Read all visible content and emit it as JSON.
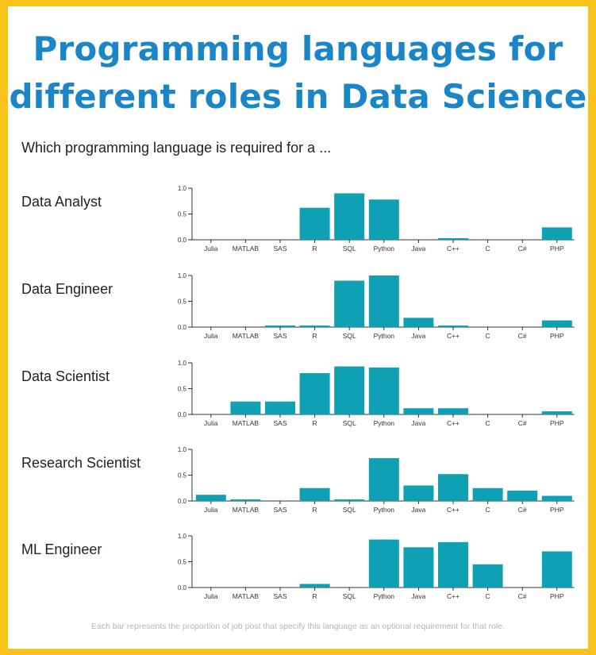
{
  "title": "Programming languages for different roles in Data Science",
  "subtitle": "Which programming language is required for a ...",
  "footnote": "Each bar represents the proportion of job post that specify this language as an optional requirement for that role.",
  "colors": {
    "border": "#f7c21a",
    "title": "#1a86c8",
    "bar": "#10a0b4"
  },
  "chart_data": {
    "type": "bar",
    "categories": [
      "Julia",
      "MATLAB",
      "SAS",
      "R",
      "SQL",
      "Python",
      "Java",
      "C++",
      "C",
      "C#",
      "PHP"
    ],
    "yticks": [
      "0.0",
      "0.5",
      "1.0"
    ],
    "ylim": [
      0,
      1.0
    ],
    "series": [
      {
        "name": "Data Analyst",
        "values": [
          0.0,
          0.0,
          0.0,
          0.62,
          0.9,
          0.78,
          0.0,
          0.03,
          0.0,
          0.0,
          0.24
        ]
      },
      {
        "name": "Data Engineer",
        "values": [
          0.0,
          0.0,
          0.03,
          0.03,
          0.9,
          1.0,
          0.18,
          0.03,
          0.0,
          0.0,
          0.13
        ]
      },
      {
        "name": "Data Scientist",
        "values": [
          0.0,
          0.25,
          0.25,
          0.8,
          0.93,
          0.91,
          0.12,
          0.12,
          0.0,
          0.0,
          0.06
        ]
      },
      {
        "name": "Research Scientist",
        "values": [
          0.12,
          0.02,
          0.0,
          0.25,
          0.02,
          0.83,
          0.3,
          0.52,
          0.25,
          0.2,
          0.1
        ]
      },
      {
        "name": "ML Engineer",
        "values": [
          0.0,
          0.0,
          0.0,
          0.07,
          0.0,
          0.93,
          0.78,
          0.88,
          0.45,
          0.0,
          0.7
        ]
      }
    ]
  }
}
